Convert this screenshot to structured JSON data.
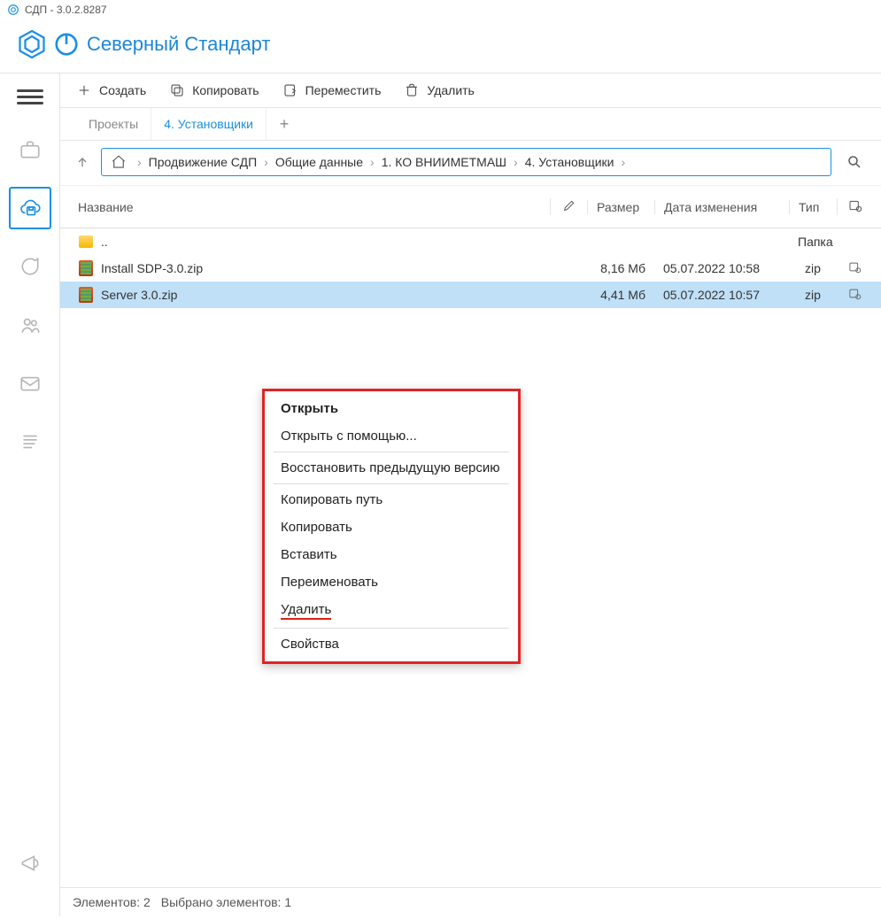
{
  "window_title": "СДП - 3.0.2.8287",
  "brand": "Северный Стандарт",
  "toolbar": {
    "create": "Создать",
    "copy": "Копировать",
    "move": "Переместить",
    "delete": "Удалить"
  },
  "tabs": [
    {
      "label": "Проекты",
      "active": false
    },
    {
      "label": "4. Установщики",
      "active": true
    }
  ],
  "breadcrumbs": [
    "Продвижение СДП",
    "Общие данные",
    "1. КО ВНИИМЕТМАШ",
    "4. Установщики"
  ],
  "columns": {
    "name": "Название",
    "size": "Размер",
    "date": "Дата изменения",
    "type": "Тип"
  },
  "rows": [
    {
      "icon": "folder",
      "name": "..",
      "size": "",
      "date": "",
      "type": "Папка",
      "cal": false,
      "selected": false
    },
    {
      "icon": "zip",
      "name": "Install SDP-3.0.zip",
      "size": "8,16 Мб",
      "date": "05.07.2022 10:58",
      "type": "zip",
      "cal": true,
      "selected": false
    },
    {
      "icon": "zip",
      "name": "Server 3.0.zip",
      "size": "4,41 Мб",
      "date": "05.07.2022 10:57",
      "type": "zip",
      "cal": true,
      "selected": true
    }
  ],
  "context_menu": {
    "open": "Открыть",
    "open_with": "Открыть с помощью...",
    "restore": "Восстановить предыдущую версию",
    "copy_path": "Копировать путь",
    "copy": "Копировать",
    "paste": "Вставить",
    "rename": "Переименовать",
    "delete": "Удалить",
    "props": "Свойства"
  },
  "status": {
    "elements": "Элементов: 2",
    "selected": "Выбрано элементов: 1"
  }
}
